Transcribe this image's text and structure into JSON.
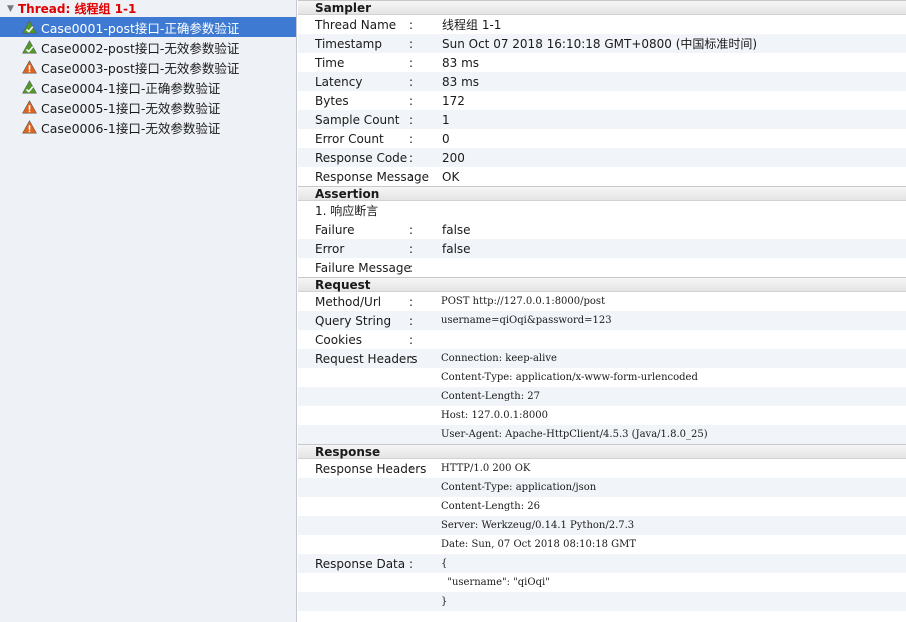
{
  "tree": {
    "thread_label": "Thread: 线程组 1-1",
    "cases": [
      {
        "label": "Case0001-post接口-正确参数验证",
        "status": "pass",
        "selected": true
      },
      {
        "label": "Case0002-post接口-无效参数验证",
        "status": "pass",
        "selected": false
      },
      {
        "label": "Case0003-post接口-无效参数验证",
        "status": "warn",
        "selected": false
      },
      {
        "label": "Case0004-1接口-正确参数验证",
        "status": "pass",
        "selected": false
      },
      {
        "label": "Case0005-1接口-无效参数验证",
        "status": "warn",
        "selected": false
      },
      {
        "label": "Case0006-1接口-无效参数验证",
        "status": "warn",
        "selected": false
      }
    ]
  },
  "sampler": {
    "title": "Sampler",
    "rows": [
      {
        "key": "Thread Name",
        "value": "线程组 1-1"
      },
      {
        "key": "Timestamp",
        "value": "Sun Oct 07 2018 16:10:18 GMT+0800 (中国标准时间)"
      },
      {
        "key": "Time",
        "value": "83 ms"
      },
      {
        "key": "Latency",
        "value": "83 ms"
      },
      {
        "key": "Bytes",
        "value": "172"
      },
      {
        "key": "Sample Count",
        "value": "1"
      },
      {
        "key": "Error Count",
        "value": "0"
      },
      {
        "key": "Response Code",
        "value": "200"
      },
      {
        "key": "Response Message",
        "value": "OK"
      }
    ]
  },
  "assertion": {
    "title": "Assertion",
    "item": "1. 响应断言",
    "rows": [
      {
        "key": "Failure",
        "value": "false"
      },
      {
        "key": "Error",
        "value": "false"
      },
      {
        "key": "Failure Message",
        "value": ""
      }
    ]
  },
  "request": {
    "title": "Request",
    "rows": [
      {
        "key": "Method/Url",
        "value": "POST http://127.0.0.1:8000/post"
      },
      {
        "key": "Query String",
        "value": "username=qiOqi&password=123"
      },
      {
        "key": "Cookies",
        "value": ""
      },
      {
        "key": "Request Headers",
        "value": "Connection: keep-alive"
      },
      {
        "key": "",
        "value": "Content-Type: application/x-www-form-urlencoded"
      },
      {
        "key": "",
        "value": "Content-Length: 27"
      },
      {
        "key": "",
        "value": "Host: 127.0.0.1:8000"
      },
      {
        "key": "",
        "value": "User-Agent: Apache-HttpClient/4.5.3 (Java/1.8.0_25)"
      }
    ]
  },
  "response": {
    "title": "Response",
    "rows": [
      {
        "key": "Response Headers",
        "value": "HTTP/1.0 200 OK"
      },
      {
        "key": "",
        "value": "Content-Type: application/json"
      },
      {
        "key": "",
        "value": "Content-Length: 26"
      },
      {
        "key": "",
        "value": "Server: Werkzeug/0.14.1 Python/2.7.3"
      },
      {
        "key": "",
        "value": "Date: Sun, 07 Oct 2018 08:10:18 GMT"
      },
      {
        "key": "Response Data",
        "value": "{"
      },
      {
        "key": "",
        "value": "  \"username\": \"qiOqi\""
      },
      {
        "key": "",
        "value": "}"
      }
    ]
  },
  "separator": ":",
  "colors": {
    "selected_bg": "#3f7ad2",
    "thread_label": "#e00000",
    "pass_icon": "#4f9a2a",
    "warn_icon": "#e0641b"
  }
}
